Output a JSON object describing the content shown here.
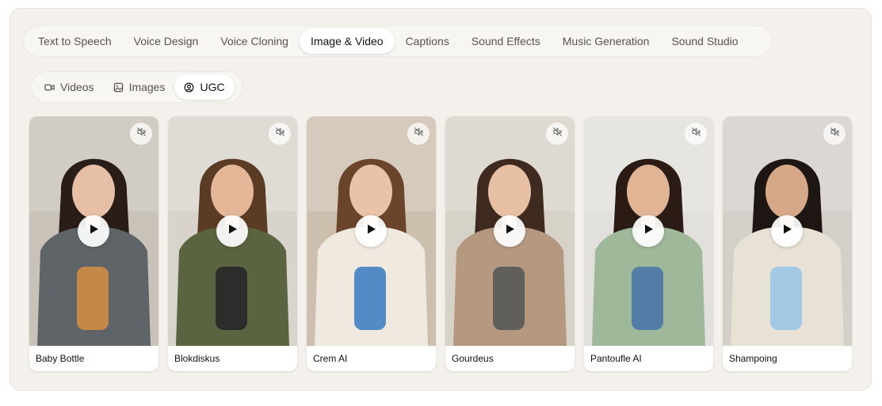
{
  "main_tabs": [
    {
      "label": "Text to Speech",
      "active": false
    },
    {
      "label": "Voice Design",
      "active": false
    },
    {
      "label": "Voice Cloning",
      "active": false
    },
    {
      "label": "Image & Video",
      "active": true
    },
    {
      "label": "Captions",
      "active": false
    },
    {
      "label": "Sound Effects",
      "active": false
    },
    {
      "label": "Music Generation",
      "active": false
    },
    {
      "label": "Sound Studio",
      "active": false
    }
  ],
  "sub_tabs": [
    {
      "label": "Videos",
      "icon": "video-camera-icon",
      "active": false
    },
    {
      "label": "Images",
      "icon": "image-icon",
      "active": false
    },
    {
      "label": "UGC",
      "icon": "user-circle-icon",
      "active": true
    }
  ],
  "cards": [
    {
      "title": "Baby Bottle",
      "bg": "#c9c2b8",
      "shirt": "#5f6468",
      "hair": "#2a1d17",
      "skin": "#e6bfa6",
      "prop": "#c98a46"
    },
    {
      "title": "Blokdiskus",
      "bg": "#d8d4cc",
      "shirt": "#5b6440",
      "hair": "#5a3b24",
      "skin": "#e4b798",
      "prop": "#2a2a2a"
    },
    {
      "title": "Crem AI",
      "bg": "#cdbfae",
      "shirt": "#efe9e0",
      "hair": "#6a452c",
      "skin": "#e9c2a8",
      "prop": "#4a86c5"
    },
    {
      "title": "Gourdeus",
      "bg": "#d7d2c8",
      "shirt": "#b59880",
      "hair": "#3e2a1e",
      "skin": "#e7c0a4",
      "prop": "#5c5c5a"
    },
    {
      "title": "Pantoufle AI",
      "bg": "#e2e0dc",
      "shirt": "#9fb89a",
      "hair": "#2a1c15",
      "skin": "#e2b496",
      "prop": "#4f78a8"
    },
    {
      "title": "Shampoing",
      "bg": "#d3cfc9",
      "shirt": "#e8e1d6",
      "hair": "#1e1612",
      "skin": "#d6a888",
      "prop": "#9ec8e6"
    }
  ]
}
